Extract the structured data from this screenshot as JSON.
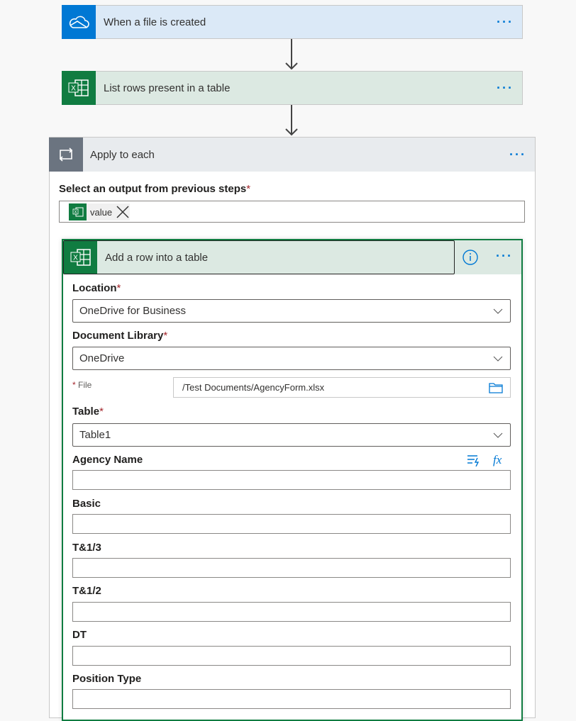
{
  "steps": [
    {
      "title": "When a file is created",
      "icon": "onedrive-cloud-icon",
      "color": "#0078d4"
    },
    {
      "title": "List rows present in a table",
      "icon": "excel-icon",
      "color": "#107c41"
    }
  ],
  "apply_each": {
    "title": "Apply to each",
    "icon": "loop-icon",
    "output_label": "Select an output from previous steps",
    "required_mark": "*",
    "token": "value"
  },
  "action": {
    "title": "Add a row into a table",
    "fields": {
      "location": {
        "label": "Location",
        "value": "OneDrive for Business"
      },
      "library": {
        "label": "Document Library",
        "value": "OneDrive"
      },
      "file": {
        "label": "File",
        "value": "/Test Documents/AgencyForm.xlsx"
      },
      "table": {
        "label": "Table",
        "value": "Table1"
      }
    },
    "columns": [
      "Agency Name",
      "Basic",
      "T&1/3",
      "T&1/2",
      "DT",
      "Position Type"
    ]
  },
  "more_label": "···",
  "colors": {
    "accent": "#0078d4",
    "excel": "#107c41",
    "required": "#a4262c"
  }
}
